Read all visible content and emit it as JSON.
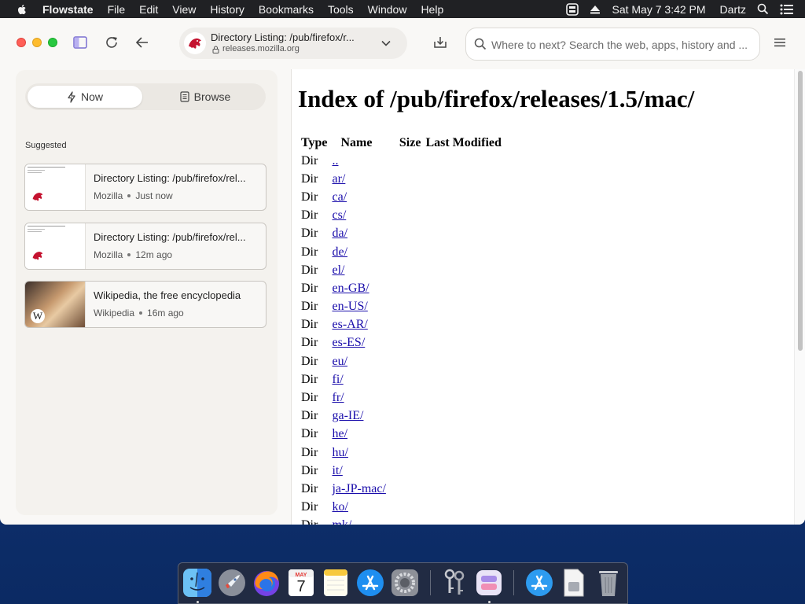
{
  "menubar": {
    "app_name": "Flowstate",
    "items": [
      "File",
      "Edit",
      "View",
      "History",
      "Bookmarks",
      "Tools",
      "Window",
      "Help"
    ],
    "clock": "Sat May 7  3:42 PM",
    "user": "Dartz"
  },
  "toolbar": {
    "tab_title": "Directory Listing: /pub/firefox/r...",
    "domain": "releases.mozilla.org",
    "search_placeholder": "Where to next? Search the web, apps, history and ..."
  },
  "sidebar": {
    "tabs": {
      "now": "Now",
      "browse": "Browse"
    },
    "section_label": "Suggested",
    "cards": [
      {
        "title": "Directory Listing: /pub/firefox/rel...",
        "source": "Mozilla",
        "time": "Just now"
      },
      {
        "title": "Directory Listing: /pub/firefox/rel...",
        "source": "Mozilla",
        "time": "12m ago"
      },
      {
        "title": "Wikipedia, the free encyclopedia",
        "source": "Wikipedia",
        "time": "16m ago"
      }
    ]
  },
  "page": {
    "heading": "Index of /pub/firefox/releases/1.5/mac/",
    "columns": [
      "Type",
      "Name",
      "Size",
      "Last Modified"
    ],
    "rows": [
      {
        "type": "Dir",
        "name": ".."
      },
      {
        "type": "Dir",
        "name": "ar/"
      },
      {
        "type": "Dir",
        "name": "ca/"
      },
      {
        "type": "Dir",
        "name": "cs/"
      },
      {
        "type": "Dir",
        "name": "da/"
      },
      {
        "type": "Dir",
        "name": "de/"
      },
      {
        "type": "Dir",
        "name": "el/"
      },
      {
        "type": "Dir",
        "name": "en-GB/"
      },
      {
        "type": "Dir",
        "name": "en-US/"
      },
      {
        "type": "Dir",
        "name": "es-AR/"
      },
      {
        "type": "Dir",
        "name": "es-ES/"
      },
      {
        "type": "Dir",
        "name": "eu/"
      },
      {
        "type": "Dir",
        "name": "fi/"
      },
      {
        "type": "Dir",
        "name": "fr/"
      },
      {
        "type": "Dir",
        "name": "ga-IE/"
      },
      {
        "type": "Dir",
        "name": "he/"
      },
      {
        "type": "Dir",
        "name": "hu/"
      },
      {
        "type": "Dir",
        "name": "it/"
      },
      {
        "type": "Dir",
        "name": "ja-JP-mac/"
      },
      {
        "type": "Dir",
        "name": "ko/"
      },
      {
        "type": "Dir",
        "name": "mk/"
      }
    ]
  },
  "dock": {
    "calendar_month": "MAY",
    "calendar_day": "7"
  },
  "colors": {
    "menubar_bg": "#202124",
    "link": "#1a0dab",
    "desktop": "#123474"
  }
}
